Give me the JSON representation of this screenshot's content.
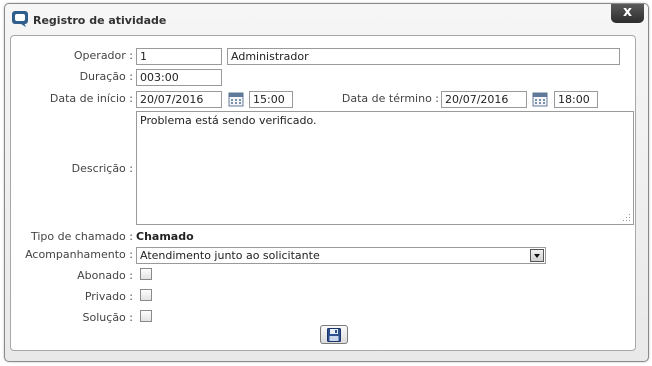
{
  "dialog": {
    "title": "Registro de atividade",
    "close_label": "x",
    "icon": "chat-app-icon"
  },
  "form": {
    "operador": {
      "label": "Operador :",
      "code": "1",
      "name": "Administrador"
    },
    "duracao": {
      "label": "Duração :",
      "value": "003:00"
    },
    "data_inicio": {
      "label": "Data de início :",
      "date": "20/07/2016",
      "time": "15:00",
      "icon": "calendar-icon"
    },
    "data_termino": {
      "label": "Data de término :",
      "date": "20/07/2016",
      "time": "18:00",
      "icon": "calendar-icon"
    },
    "descricao": {
      "label": "Descrição :",
      "value": "Problema está sendo verificado."
    },
    "tipo_chamado": {
      "label": "Tipo de chamado :",
      "value": "Chamado"
    },
    "acompanhamento": {
      "label": "Acompanhamento :",
      "selected": "Atendimento junto ao solicitante"
    },
    "abonado": {
      "label": "Abonado :",
      "checked": false
    },
    "privado": {
      "label": "Privado :",
      "checked": false
    },
    "solucao": {
      "label": "Solução :",
      "checked": false
    },
    "save_icon": "floppy-disk-icon"
  }
}
